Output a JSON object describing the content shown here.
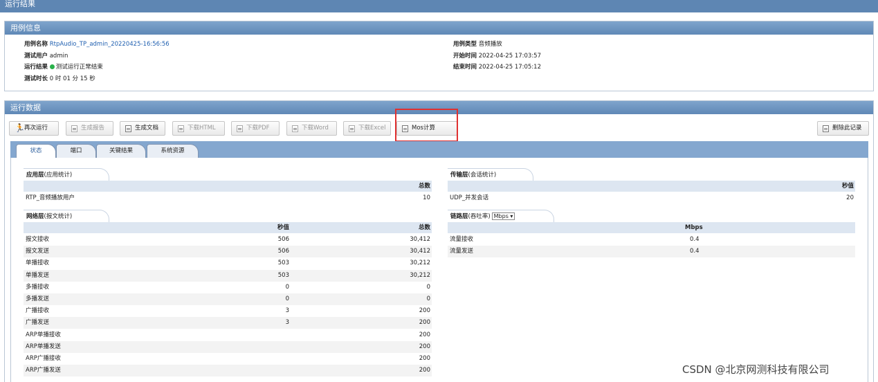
{
  "page": {
    "title": "运行结果"
  },
  "case_info": {
    "header": "用例信息",
    "case_name_label": "用例名称",
    "case_name": "RtpAudio_TP_admin_20220425-16:56:56",
    "test_user_label": "测试用户",
    "test_user": "admin",
    "result_label": "运行结果",
    "result": "测试运行正常结束",
    "duration_label": "测试时长",
    "duration": "0 时 01 分 15 秒",
    "case_type_label": "用例类型",
    "case_type": "音频播放",
    "start_label": "开始时间",
    "start": "2022-04-25 17:03:57",
    "end_label": "结束时间",
    "end": "2022-04-25 17:05:12",
    "status_color": "#29b14a"
  },
  "run_data": {
    "header": "运行数据",
    "buttons": {
      "rerun": "再次运行",
      "gen_report": "生成报告",
      "gen_doc": "生成文档",
      "dl_html": "下载HTML",
      "dl_pdf": "下载PDF",
      "dl_word": "下载Word",
      "dl_excel": "下载Excel",
      "mos": "Mos计算",
      "delete": "删除此记录"
    },
    "tabs": [
      "状态",
      "端口",
      "关键结果",
      "系统资源"
    ]
  },
  "app_layer": {
    "title": "应用层",
    "subtitle": "(应用统计)",
    "col_total": "总数",
    "rows": [
      {
        "name": "RTP_音频播放用户",
        "total": "10"
      }
    ]
  },
  "transport_layer": {
    "title": "传输层",
    "subtitle": "(会话统计)",
    "col_sec": "秒值",
    "rows": [
      {
        "name": "UDP_并发会话",
        "sec": "20"
      }
    ]
  },
  "network_layer": {
    "title": "网络层",
    "subtitle": "(报文统计)",
    "col_sec": "秒值",
    "col_total": "总数",
    "rows": [
      {
        "name": "报文接收",
        "sec": "506",
        "total": "30,412"
      },
      {
        "name": "报文发送",
        "sec": "506",
        "total": "30,412"
      },
      {
        "name": "单播接收",
        "sec": "503",
        "total": "30,212"
      },
      {
        "name": "单播发送",
        "sec": "503",
        "total": "30,212"
      },
      {
        "name": "多播接收",
        "sec": "0",
        "total": "0"
      },
      {
        "name": "多播发送",
        "sec": "0",
        "total": "0"
      },
      {
        "name": "广播接收",
        "sec": "3",
        "total": "200"
      },
      {
        "name": "广播发送",
        "sec": "3",
        "total": "200"
      },
      {
        "name": "ARP单播接收",
        "sec": "",
        "total": "200"
      },
      {
        "name": "ARP单播发送",
        "sec": "",
        "total": "200"
      },
      {
        "name": "ARP广播接收",
        "sec": "",
        "total": "200"
      },
      {
        "name": "ARP广播发送",
        "sec": "",
        "total": "200"
      }
    ]
  },
  "link_layer": {
    "title": "链路层",
    "subtitle": "(吞吐率)",
    "unit_select": "Mbps ▾",
    "col_unit": "Mbps",
    "rows": [
      {
        "name": "流量接收",
        "value": "0.4"
      },
      {
        "name": "流量发送",
        "value": "0.4"
      }
    ]
  },
  "watermark": "CSDN @北京网测科技有限公司"
}
